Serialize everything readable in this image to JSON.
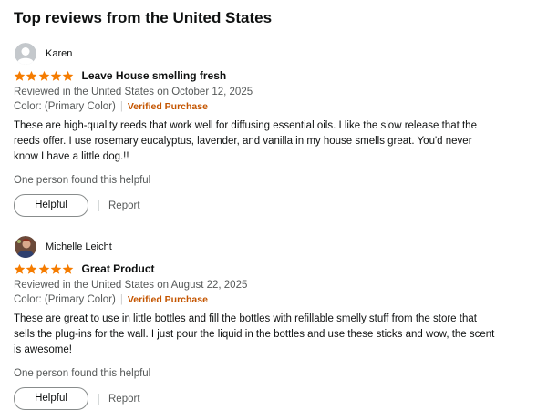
{
  "section_title": "Top reviews from the United States",
  "reviews": [
    {
      "name": "Karen",
      "rating": 5,
      "title": "Leave House smelling fresh",
      "date": "Reviewed in the United States on October 12, 2025",
      "color": "Color: (Primary Color)",
      "verified": "Verified Purchase",
      "body": "These are high-quality reeds that work well for diffusing essential oils. I like the slow release that the reeds offer. I use rosemary eucalyptus, lavender, and vanilla in my house smells great. You'd never know I have a little dog.!!",
      "helpful_text": "One person found this helpful",
      "helpful_label": "Helpful",
      "report_label": "Report"
    },
    {
      "name": "Michelle Leicht",
      "rating": 5,
      "title": "Great Product",
      "date": "Reviewed in the United States on August 22, 2025",
      "color": "Color: (Primary Color)",
      "verified": "Verified Purchase",
      "body": "These are great to use in little bottles and fill the bottles with refillable smelly stuff from the store that sells the plug-ins for the wall. I just pour the liquid in the bottles and use these sticks and wow, the scent is awesome!",
      "helpful_text": "One person found this helpful",
      "helpful_label": "Helpful",
      "report_label": "Report"
    }
  ],
  "colors": {
    "star": "#f57c00",
    "verified": "#c45500",
    "muted": "#565959"
  }
}
